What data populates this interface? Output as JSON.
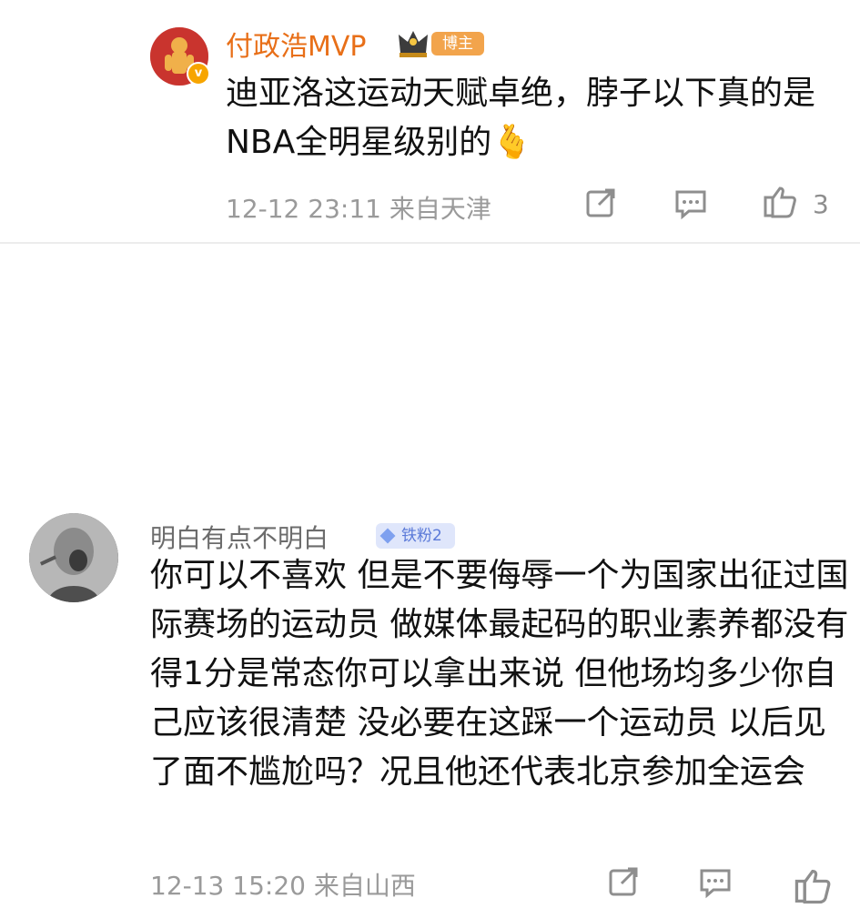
{
  "comments": [
    {
      "username": "付政浩MVP",
      "badge": "博主",
      "verified_symbol": "v",
      "text": "迪亚洛这运动天赋卓绝，脖子以下真的是NBA全明星级别的🫰",
      "timestamp": "12-12 23:11",
      "location": "来自天津",
      "like_count": "3",
      "icons": [
        "crown-icon",
        "share-icon",
        "comment-icon",
        "like-icon"
      ]
    },
    {
      "username": "明白有点不明白",
      "badge": "铁粉2",
      "text": "你可以不喜欢 但是不要侮辱一个为国家出征过国际赛场的运动员 做媒体最起码的职业素养都没有 得1分是常态你可以拿出来说 但他场均多少你自己应该很清楚 没必要在这踩一个运动员 以后见了面不尴尬吗？况且他还代表北京参加全运会",
      "timestamp": "12-13 15:20",
      "location": "来自山西",
      "icons": [
        "diamond-icon",
        "share-icon",
        "comment-icon",
        "like-icon"
      ]
    }
  ],
  "colors": {
    "username_vip": "#e86f18",
    "username_normal": "#6c6c6c",
    "body_text": "#111111",
    "meta_text": "#9a9a9a",
    "blogger_badge_bg": "#f2a44c",
    "fan_badge_bg": "#dfe6fb",
    "fan_badge_text": "#5a79d8",
    "divider": "#ececec"
  }
}
